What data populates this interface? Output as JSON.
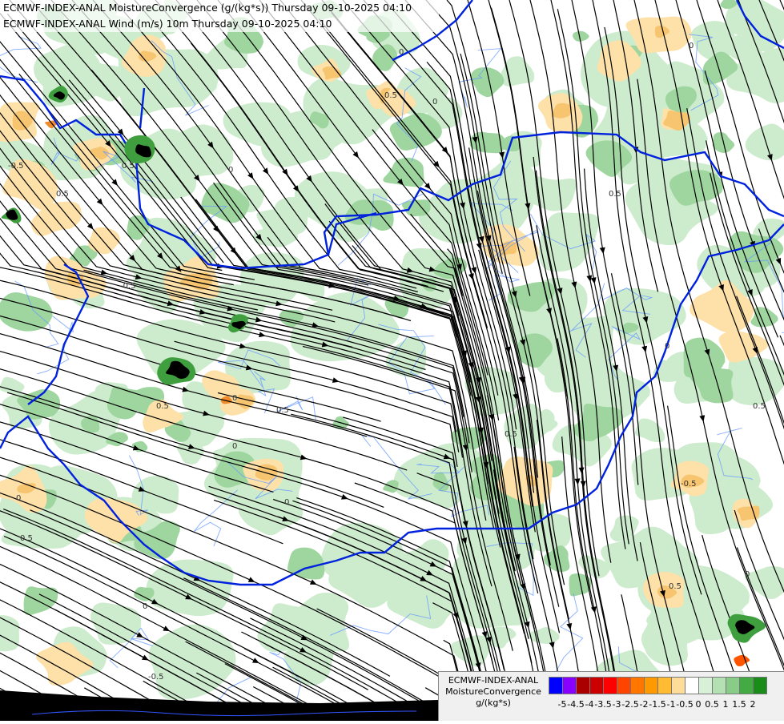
{
  "header": {
    "line1": "ECMWF-INDEX-ANAL MoistureConvergence (g/(kg*s)) Thursday 09-10-2025 04:10",
    "line2": "ECMWF-INDEX-ANAL Wind (m/s) 10m Thursday 09-10-2025 04:10"
  },
  "legend": {
    "title1": "ECMWF-INDEX-ANAL",
    "title2": "MoistureConvergence",
    "units": "g/(kg*s)",
    "colors": [
      "#0000ff",
      "#8800ff",
      "#aa0000",
      "#cc0000",
      "#ff0000",
      "#ff4400",
      "#ff7700",
      "#ff9900",
      "#ffbb33",
      "#ffdd99",
      "#ffffff",
      "#d8f0d8",
      "#b4e0b4",
      "#88cc88",
      "#44aa44",
      "#1a8c1a"
    ],
    "tick_labels": [
      "-5",
      "-4.5",
      "-4",
      "-3.5",
      "-3",
      "-2.5",
      "-2",
      "-1.5",
      "-1",
      "-0.5",
      "0",
      "0.5",
      "1",
      "1.5",
      "2"
    ]
  },
  "map": {
    "contour_labels": [
      "0",
      "0.5",
      "-0.5",
      "0.5",
      "0",
      "0.5",
      "0",
      "-0.5",
      "0",
      "0.5",
      "0",
      "0.5",
      "0",
      "0",
      "0.5",
      "0.5",
      "-0.5",
      "0.5",
      "0",
      "0",
      "0.5",
      "0",
      "0",
      "0.5",
      "-0.5",
      "0.5",
      "0.5"
    ],
    "colors": {
      "background": "#ffffff",
      "green_light": "#cdebcd",
      "green_mid": "#9fd69f",
      "green_dark": "#3f9f3f",
      "orange_light": "#fde1a8",
      "orange_mid": "#f7c470",
      "orange_dark": "#f08a2a",
      "border": "#0022dd",
      "river": "#6699ff",
      "streamline": "#000000"
    }
  }
}
